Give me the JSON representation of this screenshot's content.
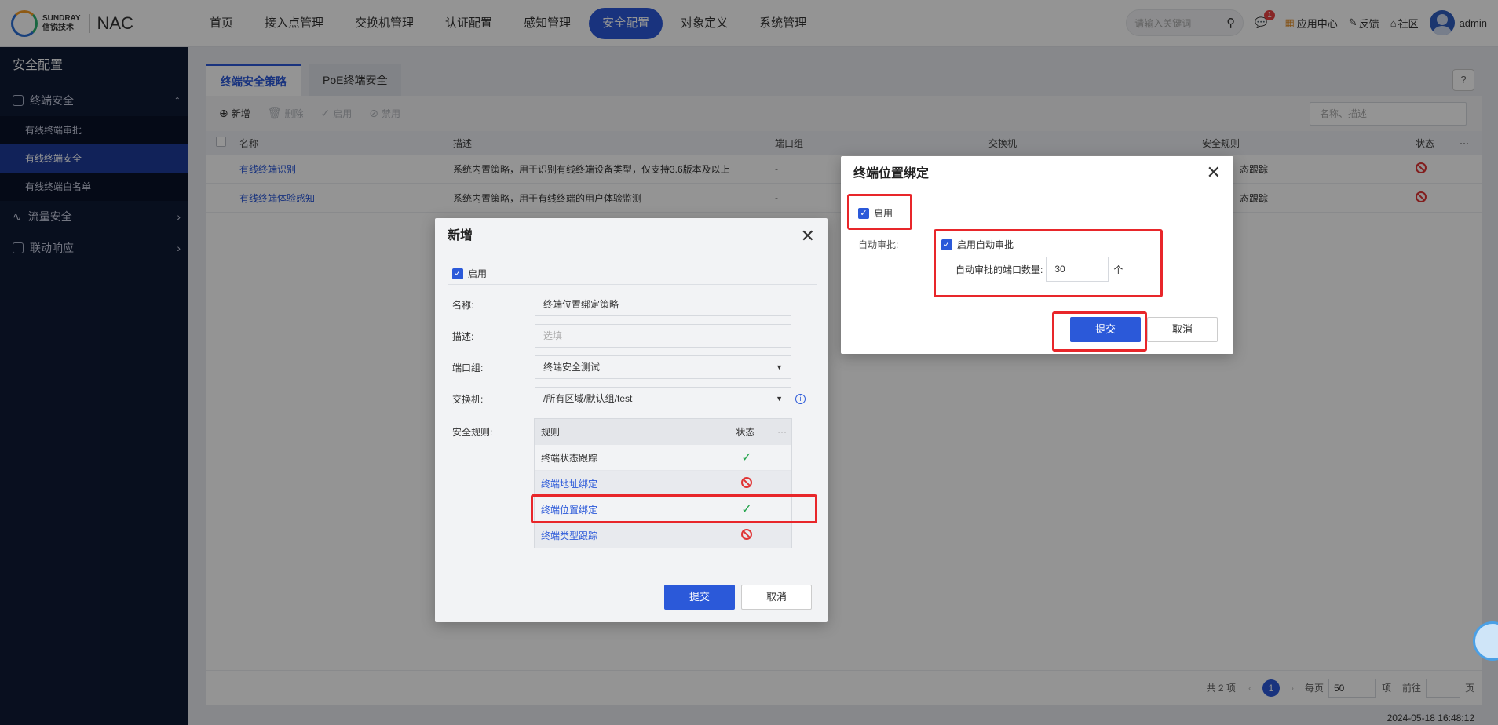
{
  "brand": {
    "company_en": "SUNDRAY",
    "company_cn": "信锐技术",
    "product": "NAC"
  },
  "nav": {
    "items": [
      "首页",
      "接入点管理",
      "交换机管理",
      "认证配置",
      "感知管理",
      "安全配置",
      "对象定义",
      "系统管理"
    ],
    "active_index": 5
  },
  "topright": {
    "search_placeholder": "请输入关键词",
    "msg_badge": "1",
    "app_center": "应用中心",
    "feedback": "反馈",
    "community": "社区",
    "user": "admin"
  },
  "sidebar": {
    "title": "安全配置",
    "groups": [
      {
        "label": "终端安全",
        "items": [
          "有线终端审批",
          "有线终端安全",
          "有线终端白名单"
        ],
        "active_item": 1
      },
      {
        "label": "流量安全"
      },
      {
        "label": "联动响应"
      }
    ]
  },
  "main": {
    "tabs": [
      "终端安全策略",
      "PoE终端安全"
    ],
    "active_tab": 0,
    "help": "?",
    "toolbar": {
      "add": "新增",
      "delete": "删除",
      "enable": "启用",
      "disable": "禁用"
    },
    "search_placeholder": "名称、描述",
    "columns": [
      "名称",
      "描述",
      "端口组",
      "交换机",
      "安全规则",
      "状态",
      "···"
    ],
    "rows": [
      {
        "name": "有线终端识别",
        "desc": "系统内置策略，用于识别有线终端设备类型，仅支持3.6版本及以上",
        "port_group": "-",
        "rules": "态跟踪"
      },
      {
        "name": "有线终端体验感知",
        "desc": "系统内置策略，用于有线终端的用户体验监测",
        "port_group": "-",
        "rules": "态跟踪"
      }
    ],
    "pager": {
      "total": "共 2 项",
      "current": "1",
      "per_page_label": "每页",
      "per_page": "50",
      "item_unit": "项",
      "goto": "前往",
      "page_unit": "页"
    },
    "timestamp": "2024-05-18 16:48:12"
  },
  "dialog_add": {
    "title": "新增",
    "enable_label": "启用",
    "name_label": "名称:",
    "name_value": "终端位置绑定策略",
    "desc_label": "描述:",
    "desc_placeholder": "选填",
    "port_group_label": "端口组:",
    "port_group_value": "终端安全测试",
    "switch_label": "交换机:",
    "switch_value": "/所有区域/默认组/test",
    "rules_label": "安全规则:",
    "rules_header": {
      "rule": "规则",
      "status": "状态",
      "more": "···"
    },
    "rules": [
      {
        "name": "终端状态跟踪",
        "status": "enabled"
      },
      {
        "name": "终端地址绑定",
        "status": "disabled"
      },
      {
        "name": "终端位置绑定",
        "status": "enabled"
      },
      {
        "name": "终端类型跟踪",
        "status": "disabled"
      }
    ],
    "submit": "提交",
    "cancel": "取消"
  },
  "dialog_bind": {
    "title": "终端位置绑定",
    "enable_label": "启用",
    "auto_label": "自动审批:",
    "auto_enable_label": "启用自动审批",
    "port_count_label": "自动审批的端口数量:",
    "port_count_value": "30",
    "port_count_unit": "个",
    "submit": "提交",
    "cancel": "取消"
  },
  "colors": {
    "primary": "#2b59d9",
    "sidebar_bg": "#0f1a35",
    "highlight": "#e8262a",
    "ok": "#22a34a",
    "forbid": "#e03434"
  }
}
